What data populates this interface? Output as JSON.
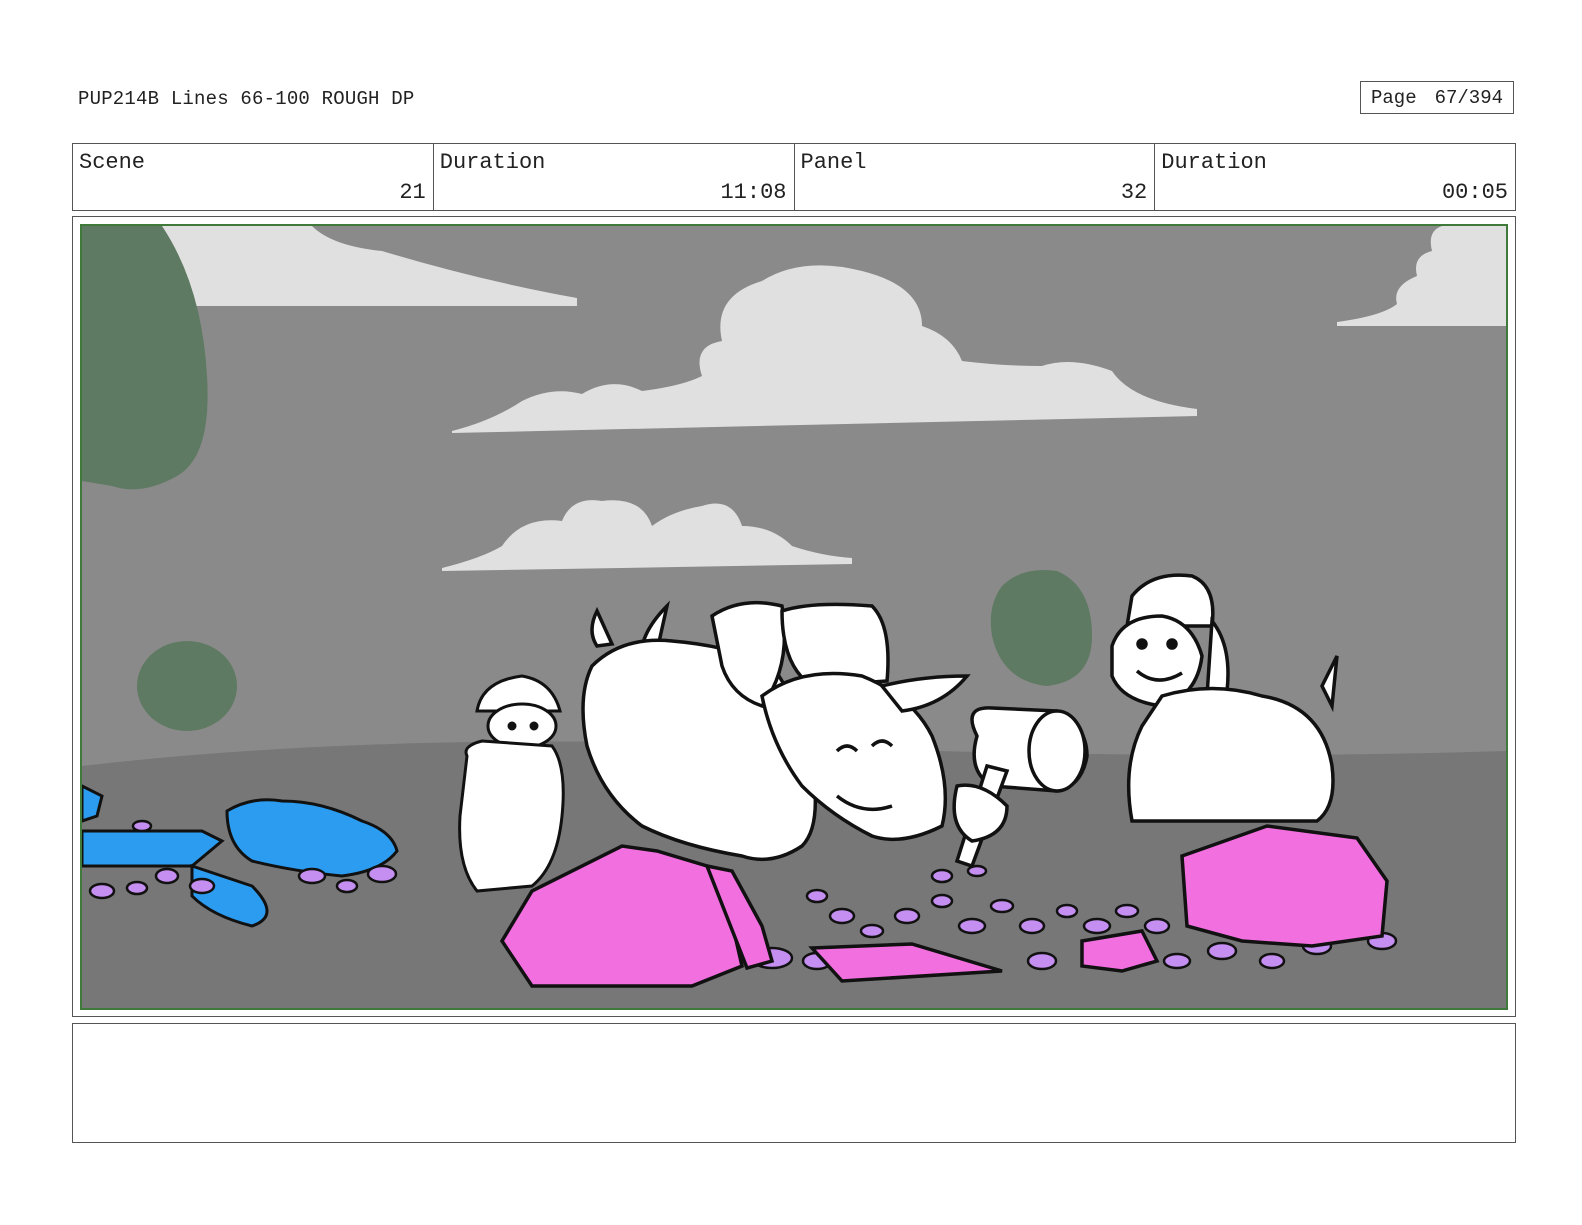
{
  "header": {
    "doc_title": "PUP214B Lines 66-100 ROUGH DP",
    "page_label": "Page",
    "page_number": "67/394"
  },
  "info": {
    "scene_label": "Scene",
    "scene_value": "21",
    "scene_duration_label": "Duration",
    "scene_duration_value": "11:08",
    "panel_label": "Panel",
    "panel_value": "32",
    "panel_duration_label": "Duration",
    "panel_duration_value": "00:05"
  },
  "colors": {
    "sky": "#8a8a8a",
    "ground": "#777777",
    "cloud": "#e0e0e0",
    "tree": "#5f7a62",
    "crystal_pink": "#f26fe0",
    "crystal_blue": "#2b9cf0",
    "pebble_purple": "#c48ff0",
    "frame_green": "#3f7a3a"
  },
  "notes": {
    "text": ""
  }
}
